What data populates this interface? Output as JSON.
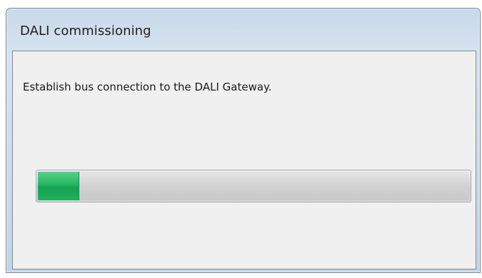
{
  "dialog": {
    "title": "DALI commissioning",
    "message": "Establish bus connection to the DALI Gateway.",
    "progress": {
      "percent": 9.5,
      "fill_color": "#1fad5c"
    }
  }
}
